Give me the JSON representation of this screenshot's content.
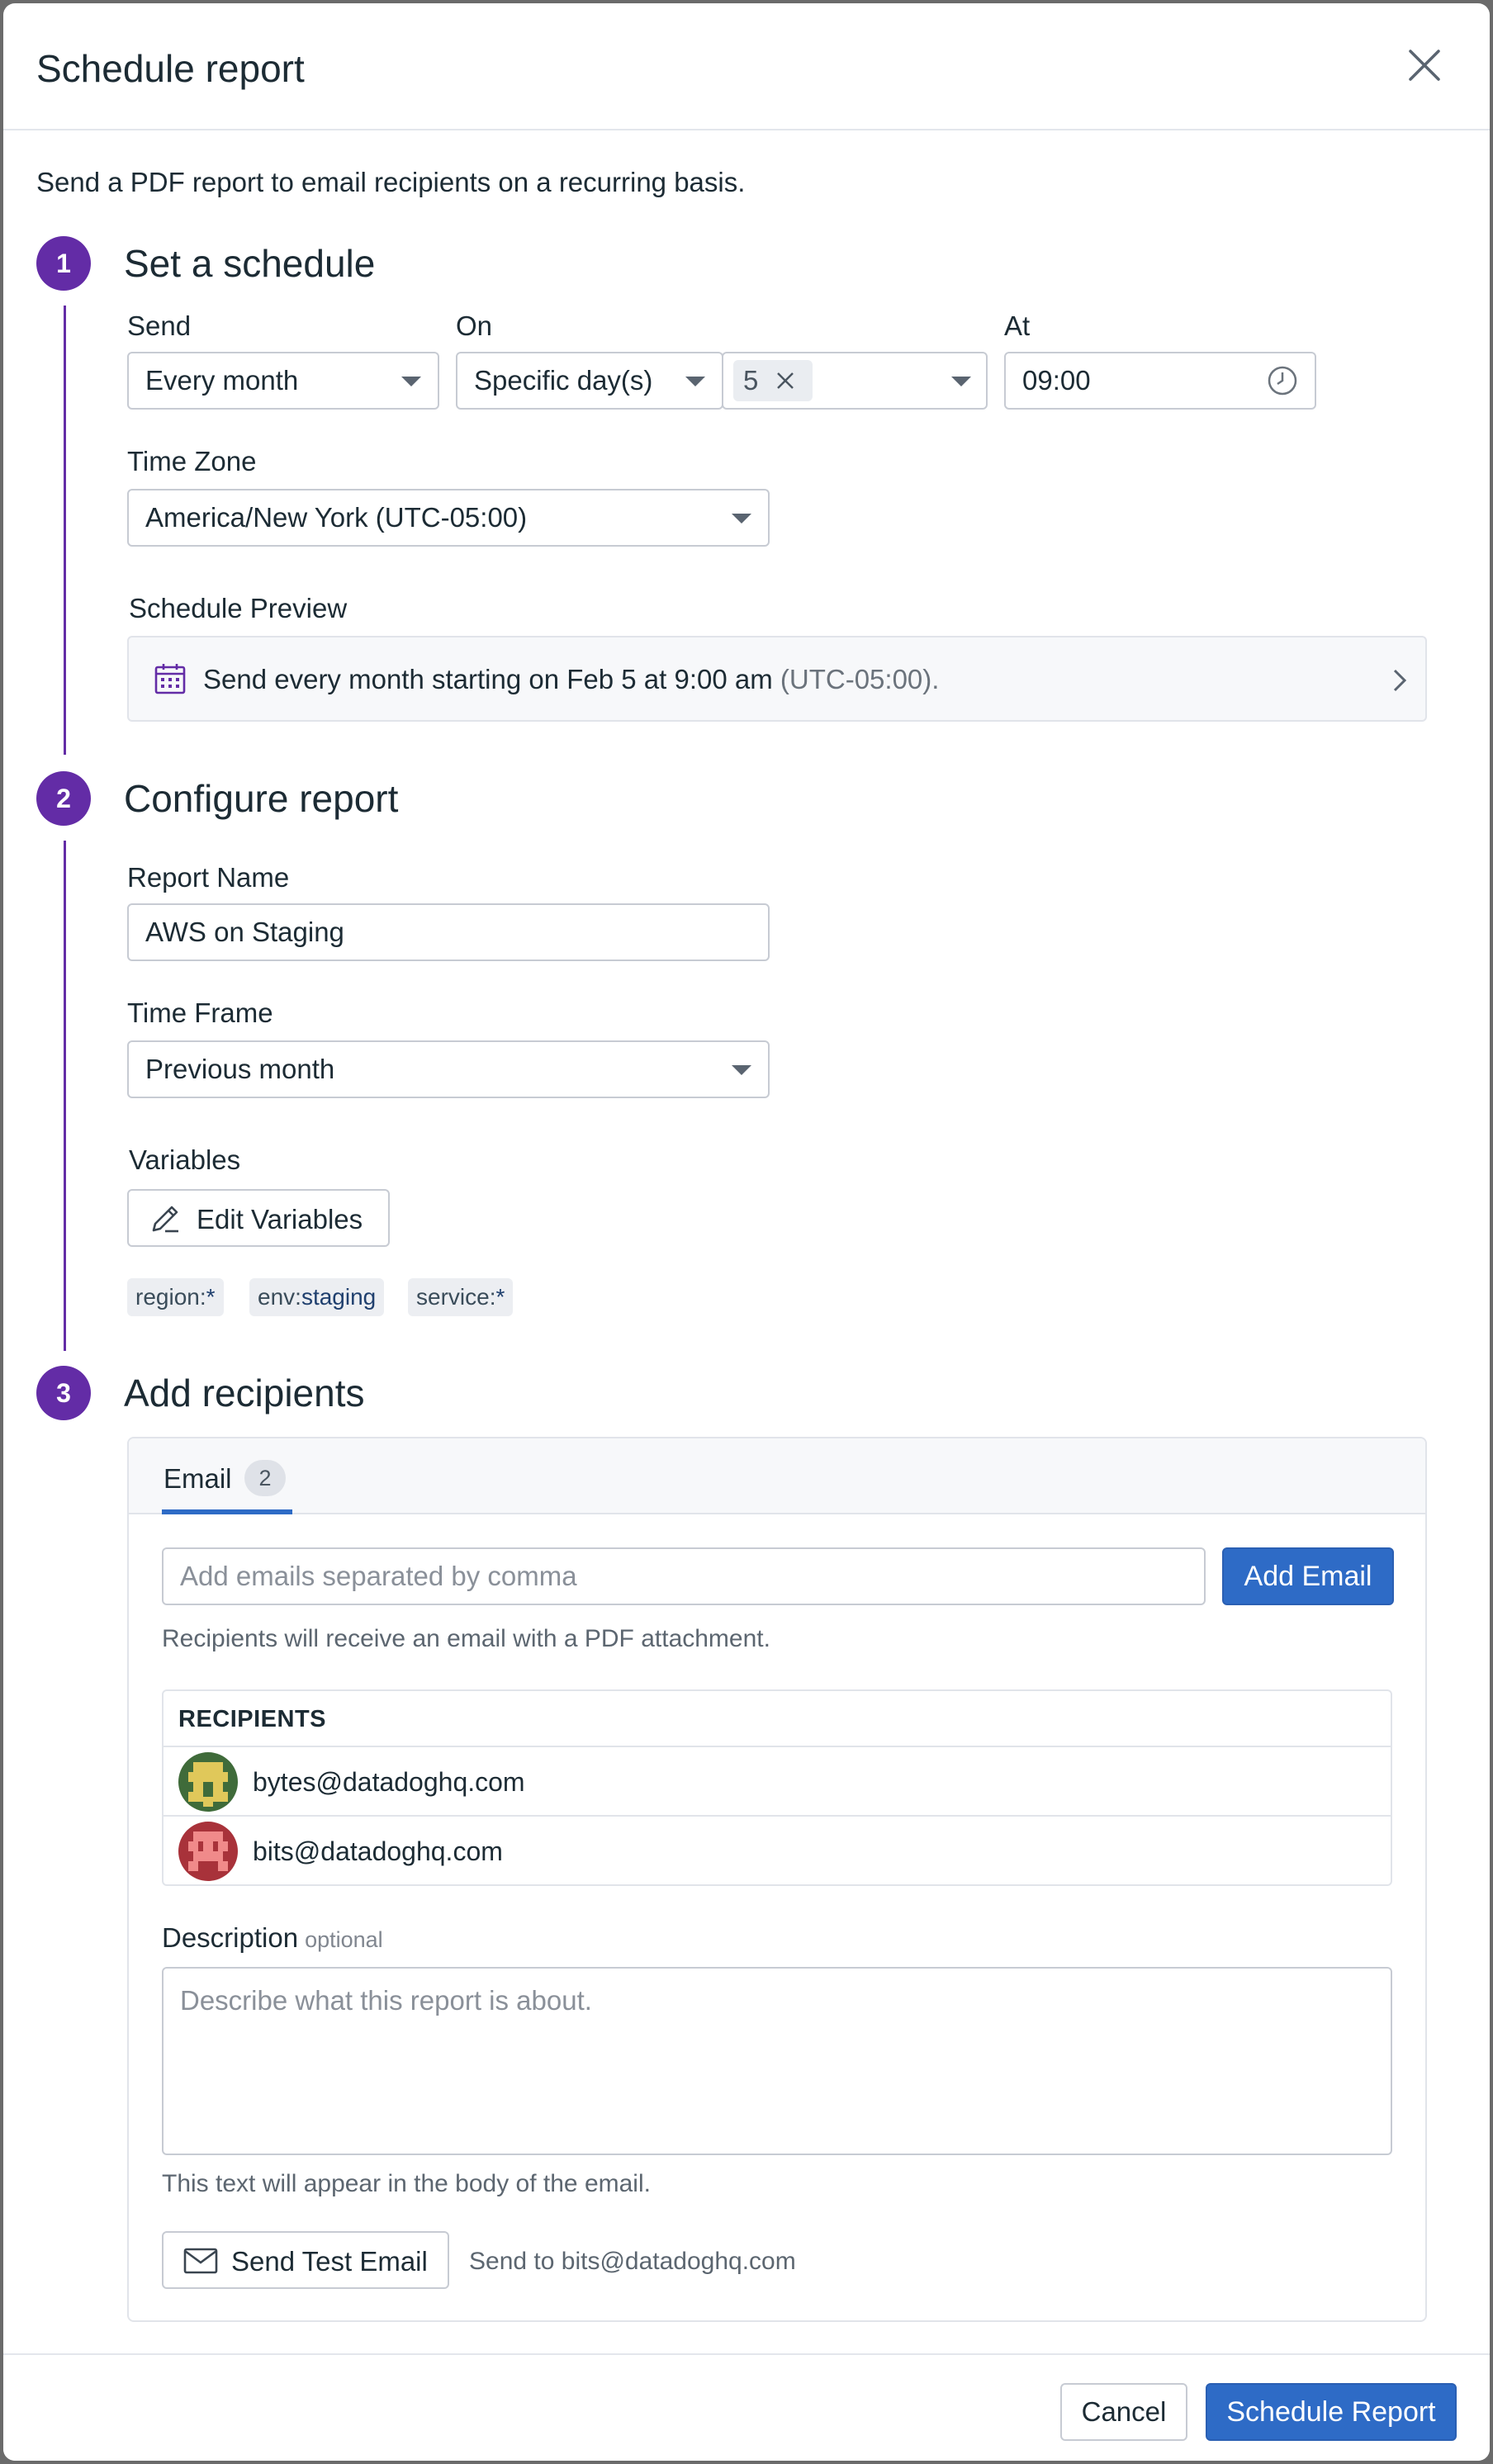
{
  "header": {
    "title": "Schedule report"
  },
  "intro": "Send a PDF report to email recipients on a recurring basis.",
  "step1": {
    "number": "1",
    "title": "Set a schedule",
    "send_label": "Send",
    "send_value": "Every month",
    "on_label": "On",
    "on_value": "Specific day(s)",
    "day_chip": "5",
    "at_label": "At",
    "at_value": "09:00",
    "timezone_label": "Time Zone",
    "timezone_value": "America/New York (UTC-05:00)",
    "preview_label": "Schedule Preview",
    "preview_text": "Send every month starting on Feb 5 at 9:00 am",
    "preview_tz": "(UTC-05:00)."
  },
  "step2": {
    "number": "2",
    "title": "Configure report",
    "report_name_label": "Report Name",
    "report_name_value": "AWS on Staging",
    "timeframe_label": "Time Frame",
    "timeframe_value": "Previous month",
    "variables_label": "Variables",
    "edit_variables_label": "Edit Variables",
    "tags": [
      {
        "key": "region:",
        "value": "*"
      },
      {
        "key": "env:",
        "value": "staging"
      },
      {
        "key": "service:",
        "value": "*"
      }
    ]
  },
  "step3": {
    "number": "3",
    "title": "Add recipients",
    "tab_label": "Email",
    "tab_count": "2",
    "email_placeholder": "Add emails separated by comma",
    "add_email_label": "Add Email",
    "email_help": "Recipients will receive an email with a PDF attachment.",
    "recipients_header": "RECIPIENTS",
    "recipients": [
      "bytes@datadoghq.com",
      "bits@datadoghq.com"
    ],
    "description_label": "Description",
    "description_optional": "optional",
    "description_placeholder": "Describe what this report is about.",
    "description_help": "This text will appear in the body of the email.",
    "send_test_label": "Send Test Email",
    "send_test_target": "Send to bits@datadoghq.com"
  },
  "footer": {
    "cancel_label": "Cancel",
    "schedule_label": "Schedule Report"
  },
  "colors": {
    "step_accent": "#632ca6",
    "primary_button": "#2e6bc6",
    "tab_underline": "#2e6bc6"
  },
  "icons": [
    "close-icon",
    "chevron-down-icon",
    "clock-icon",
    "calendar-icon",
    "chevron-right-icon",
    "pencil-icon",
    "envelope-icon"
  ]
}
